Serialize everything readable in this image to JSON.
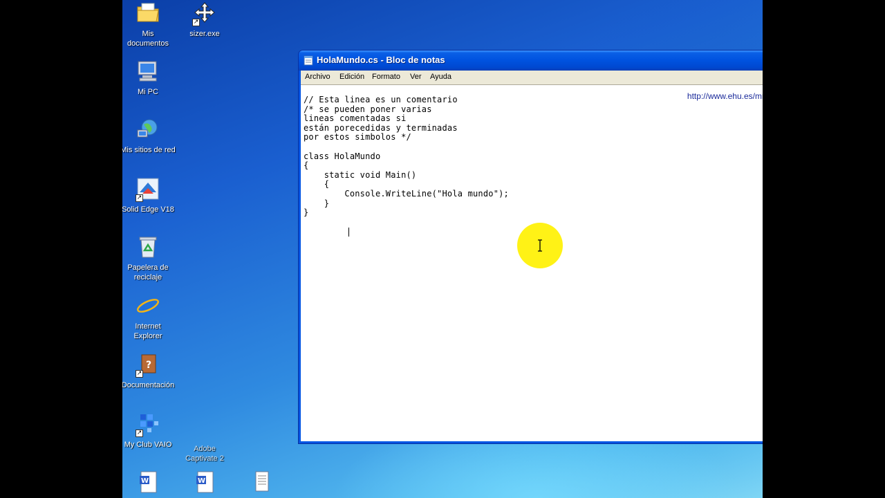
{
  "desktop": {
    "icons": [
      {
        "label": "Mis documentos",
        "icon": "my-documents-icon"
      },
      {
        "label": "sizer.exe",
        "icon": "sizer-icon"
      },
      {
        "label": "Mi PC",
        "icon": "my-computer-icon"
      },
      {
        "label": "Mis sitios de red",
        "icon": "network-places-icon"
      },
      {
        "label": "Solid Edge V18",
        "icon": "solid-edge-icon"
      },
      {
        "label": "Papelera de reciclaje",
        "icon": "recycle-bin-icon"
      },
      {
        "label": "Internet Explorer",
        "icon": "internet-explorer-icon"
      },
      {
        "label": "Documentación",
        "icon": "documentation-icon"
      },
      {
        "label": "My Club VAIO",
        "icon": "vaio-club-icon"
      },
      {
        "label": "Adobe Captivate 2",
        "icon": "captivate-icon"
      }
    ]
  },
  "window": {
    "title": "HolaMundo.cs - Bloc de notas",
    "menu": [
      "Archivo",
      "Edición",
      "Formato",
      "Ver",
      "Ayuda"
    ],
    "watermark": "http://www.ehu.es/mrodriguez",
    "code": "// Esta linea es un comentario\n/* se pueden poner varias\nlineas comentadas si\nestán porecedidas y terminadas\npor estos simbolos */\n\nclass HolaMundo\n{\n    static void Main()\n    {\n        Console.WriteLine(\"Hola mundo\");\n    }\n}"
  },
  "colors": {
    "titlebar": "#0054e3",
    "highlight": "#fff10a",
    "watermark": "#1a2a9a"
  }
}
